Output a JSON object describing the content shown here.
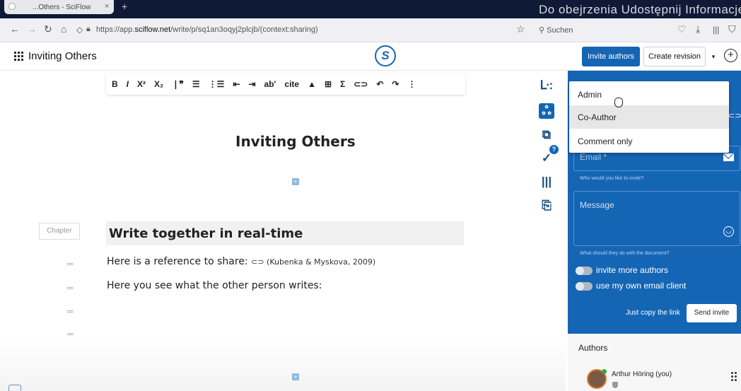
{
  "browser": {
    "tab_title": "...Others - SciFlow",
    "tab_close": "×",
    "tab_new": "+",
    "overlay_text": "Do obejrzenia   Udostępnij   Informacje",
    "url_prefix": "https://app.",
    "url_domain": "sciflow.net",
    "url_path": "/write/p/sq1an3oqyj2plcjb/(context:sharing)",
    "search_placeholder": "Suchen",
    "nav_icons": [
      "back-icon",
      "forward-icon",
      "reload-icon",
      "home-icon",
      "shield-icon",
      "lock-icon"
    ]
  },
  "header": {
    "doc_title": "Inviting Others",
    "logo_glyph": "S",
    "invite_label": "Invite authors",
    "revision_label": "Create revision",
    "caret": "▾",
    "add": "+"
  },
  "toolbar": {
    "items": [
      "B",
      "I",
      "X²",
      "X₂",
      "❘❞",
      "☰",
      "⋮☰",
      "⇤",
      "⇥",
      "ab'",
      "cite",
      "▲",
      "⊞",
      "Σ",
      "⊂⊃",
      "↶",
      "↷",
      "⋮"
    ]
  },
  "editor": {
    "heading": "Inviting Others",
    "plus": "+",
    "chapter_label": "Chapter",
    "section_title": "Write together in real-time",
    "para1_text": "Here is a reference to share: ",
    "para1_ref": "⊂⊃ (Kubenka & Myskova, 2009)",
    "para2_text": "Here you see what the other person writes:",
    "handle": "═"
  },
  "side_icons": [
    "structure-icon",
    "users-icon",
    "copy-icon",
    "check-icon",
    "library-icon",
    "document-icon"
  ],
  "side_badge": "?",
  "dropdown": {
    "options": [
      "Admin",
      "Co-Author",
      "Comment only"
    ],
    "selected": "Co-Author"
  },
  "invite_panel": {
    "email_placeholder": "Email *",
    "email_hint": "Who would you like to invite?",
    "message_placeholder": "Message",
    "message_hint": "What should they do with the document?",
    "toggle1_label": "invite more authors",
    "toggle2_label": "use my own email client",
    "copy_link_label": "Just copy the link",
    "send_label": "Send invite"
  },
  "authors": {
    "title": "Authors",
    "items": [
      {
        "name": "Arthur Höring (you)"
      }
    ]
  },
  "colors": {
    "primary": "#1565b5",
    "browser_dark": "#0e1a36"
  }
}
